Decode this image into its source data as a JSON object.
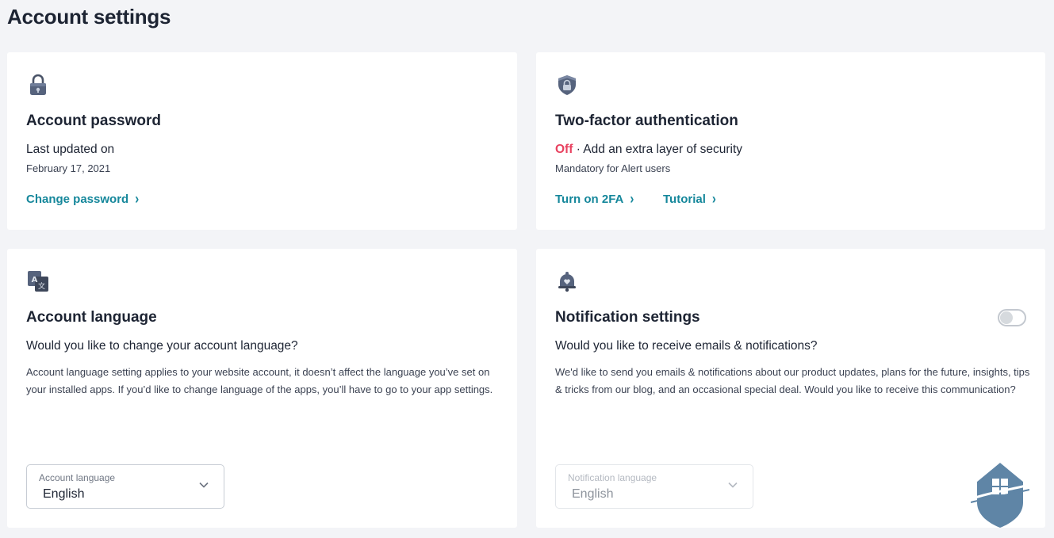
{
  "page": {
    "title": "Account settings"
  },
  "password": {
    "icon": "lock-icon",
    "title": "Account password",
    "line1": "Last updated on",
    "line2": "February 17, 2021",
    "link": "Change password"
  },
  "two_factor": {
    "icon": "shield-lock-icon",
    "title": "Two-factor authentication",
    "status": "Off",
    "status_color": "#e8415f",
    "description": " · Add an extra layer of security",
    "note": "Mandatory for Alert users",
    "link_enable": "Turn on 2FA",
    "link_tutorial": "Tutorial"
  },
  "language": {
    "icon": "translate-icon",
    "title": "Account language",
    "question": "Would you like to change your account language?",
    "paragraph": "Account language setting applies to your website account, it doesn’t affect the language you’ve set on your installed apps. If you’d like to change language of the apps, you’ll have to go to your app settings.",
    "select_label": "Account language",
    "select_value": "English"
  },
  "notifications": {
    "icon": "bell-heart-icon",
    "title": "Notification settings",
    "toggle_on": false,
    "question": "Would you like to receive emails & notifications?",
    "paragraph": "We'd like to send you emails & notifications about our product updates, plans for the future, insights, tips & tricks from our blog, and an occasional special deal. Would you like to receive this communication?",
    "select_label": "Notification language",
    "select_value": "English",
    "select_disabled": true
  },
  "colors": {
    "accent": "#15879b",
    "background": "#f3f4f7",
    "off": "#e8415f"
  },
  "watermark": {
    "icon": "house-shield-logo-icon"
  }
}
